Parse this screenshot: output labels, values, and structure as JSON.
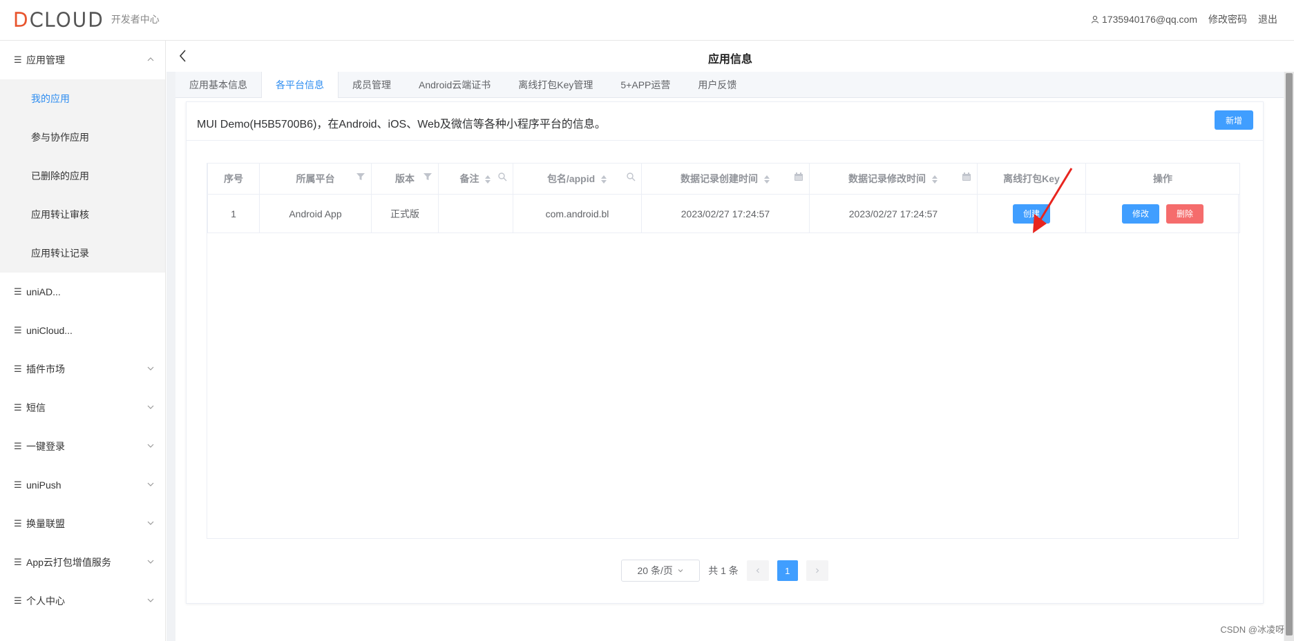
{
  "header": {
    "brand": "DCLOUD",
    "subtitle": "开发者中心",
    "user_email": "1735940176@qq.com",
    "change_password": "修改密码",
    "logout": "退出"
  },
  "sidebar": {
    "groups": [
      {
        "label": "应用管理",
        "expanded": true,
        "items": [
          {
            "label": "我的应用",
            "active": true
          },
          {
            "label": "参与协作应用"
          },
          {
            "label": "已删除的应用"
          },
          {
            "label": "应用转让审核"
          },
          {
            "label": "应用转让记录"
          }
        ]
      },
      {
        "label": "uniAD..."
      },
      {
        "label": "uniCloud..."
      },
      {
        "label": "插件市场"
      },
      {
        "label": "短信"
      },
      {
        "label": "一键登录"
      },
      {
        "label": "uniPush"
      },
      {
        "label": "换量联盟"
      },
      {
        "label": "App云打包增值服务"
      },
      {
        "label": "个人中心"
      }
    ]
  },
  "page": {
    "title": "应用信息",
    "tabs": [
      "应用基本信息",
      "各平台信息",
      "成员管理",
      "Android云端证书",
      "离线打包Key管理",
      "5+APP运营",
      "用户反馈"
    ],
    "active_tab": 1
  },
  "card": {
    "title": "MUI Demo(H5B5700B6)，在Android、iOS、Web及微信等各种小程序平台的信息。",
    "add_button": "新增"
  },
  "table": {
    "columns": [
      "序号",
      "所属平台",
      "版本",
      "备注",
      "包名/appid",
      "数据记录创建时间",
      "数据记录修改时间",
      "离线打包Key",
      "操作"
    ],
    "rows": [
      {
        "index": "1",
        "platform": "Android App",
        "version": "正式版",
        "note": "",
        "package": "com.android.bl",
        "created": "2023/02/27 17:24:57",
        "modified": "2023/02/27 17:24:57",
        "create_btn": "创建",
        "edit_btn": "修改",
        "delete_btn": "删除"
      }
    ]
  },
  "pagination": {
    "page_size": "20 条/页",
    "total": "共 1 条",
    "current_page": "1"
  },
  "watermark": "CSDN @冰凌呀",
  "colors": {
    "primary": "#409eff",
    "danger": "#f56c6c",
    "sidebar_active": "#2d8cf0",
    "annotation": "#e8251f"
  }
}
